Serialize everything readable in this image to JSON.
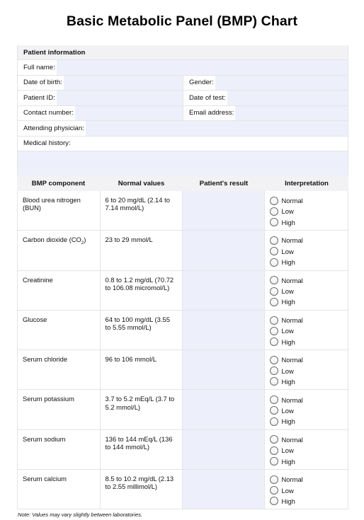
{
  "title": "Basic Metabolic Panel (BMP) Chart",
  "patient_info": {
    "header": "Patient information",
    "full_name": {
      "label": "Full name:",
      "value": ""
    },
    "date_of_birth": {
      "label": "Date of birth:",
      "value": ""
    },
    "gender": {
      "label": "Gender:",
      "value": ""
    },
    "patient_id": {
      "label": "Patient ID:",
      "value": ""
    },
    "date_of_test": {
      "label": "Date of test:",
      "value": ""
    },
    "contact_number": {
      "label": "Contact number:",
      "value": ""
    },
    "email_address": {
      "label": "Email address:",
      "value": ""
    },
    "attending_physician": {
      "label": "Attending physician:",
      "value": ""
    },
    "medical_history": {
      "label": "Medical history:",
      "value": ""
    }
  },
  "bmp_table": {
    "headers": [
      "BMP component",
      "Normal values",
      "Patient's result",
      "Interpretation"
    ],
    "interpretation_options": [
      "Normal",
      "Low",
      "High"
    ],
    "rows": [
      {
        "component": "Blood urea nitrogen (BUN)",
        "normal": "6 to 20 mg/dL (2.14 to 7.14 mmol/L)",
        "result": "",
        "selected": null
      },
      {
        "component": "Carbon dioxide (CO",
        "component_sub": "2",
        "component_suffix": ")",
        "normal": "23 to 29 mmol/L",
        "result": "",
        "selected": null
      },
      {
        "component": "Creatinine",
        "normal": "0.8 to 1.2 mg/dL (70.72 to 106.08 micromol/L)",
        "result": "",
        "selected": null
      },
      {
        "component": "Glucose",
        "normal": "64 to 100 mg/dL (3.55 to 5.55 mmol/L)",
        "result": "",
        "selected": null
      },
      {
        "component": "Serum chloride",
        "normal": "96 to 106 mmol/L",
        "result": "",
        "selected": null
      },
      {
        "component": "Serum potassium",
        "normal": "3.7 to 5.2 mEq/L (3.7 to 5.2 mmol/L)",
        "result": "",
        "selected": null
      },
      {
        "component": "Serum sodium",
        "normal": "136 to 144 mEq/L (136 to 144 mmol/L)",
        "result": "",
        "selected": null
      },
      {
        "component": "Serum calcium",
        "normal": "8.5 to 10.2 mg/dL (2.13 to 2.55 millimol/L)",
        "result": "",
        "selected": null
      }
    ]
  },
  "note": "Note: Values may vary slightly between laboratories."
}
